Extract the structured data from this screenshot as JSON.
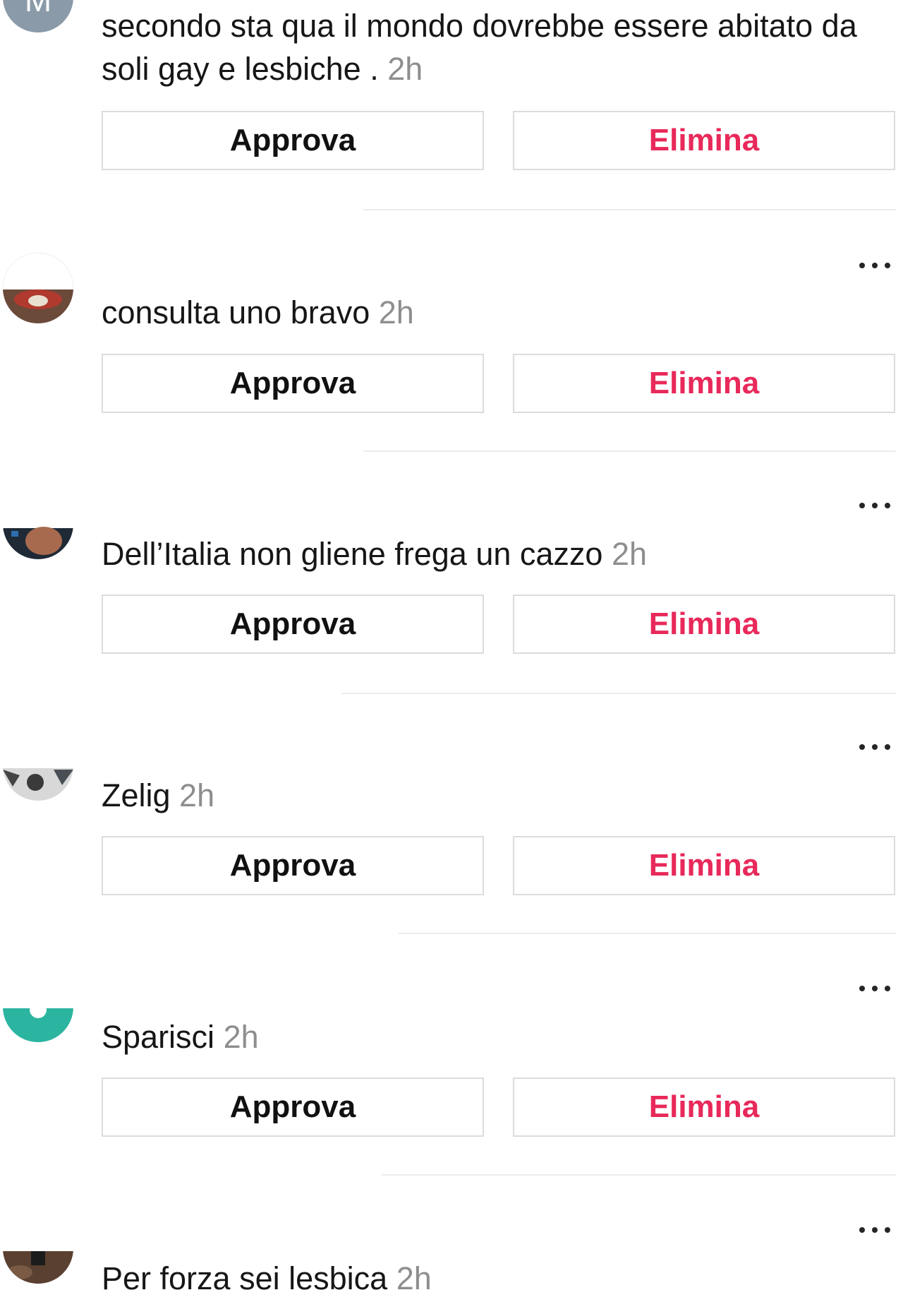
{
  "comments": [
    {
      "text": "secondo sta qua il mondo dovrebbe essere abitato da soli gay e lesbiche . ",
      "time": "2h",
      "approve_label": "Approva",
      "delete_label": "Elimina"
    },
    {
      "text": "consulta uno bravo ",
      "time": "2h",
      "approve_label": "Approva",
      "delete_label": "Elimina"
    },
    {
      "text": "Dell’Italia non gliene frega un cazzo ",
      "time": "2h",
      "approve_label": "Approva",
      "delete_label": "Elimina"
    },
    {
      "text": "Zelig ",
      "time": "2h",
      "approve_label": "Approva",
      "delete_label": "Elimina"
    },
    {
      "text": "Sparisci ",
      "time": "2h",
      "approve_label": "Approva",
      "delete_label": "Elimina"
    },
    {
      "text": "Per forza sei lesbica ",
      "time": "2h"
    }
  ],
  "icons": {
    "more": "more-options-icon",
    "avatar": "user-avatar"
  },
  "colors": {
    "delete": "#e8295a",
    "timestamp": "#8e8e8e",
    "button_border": "#dcdcdc",
    "divider": "#ececec"
  }
}
